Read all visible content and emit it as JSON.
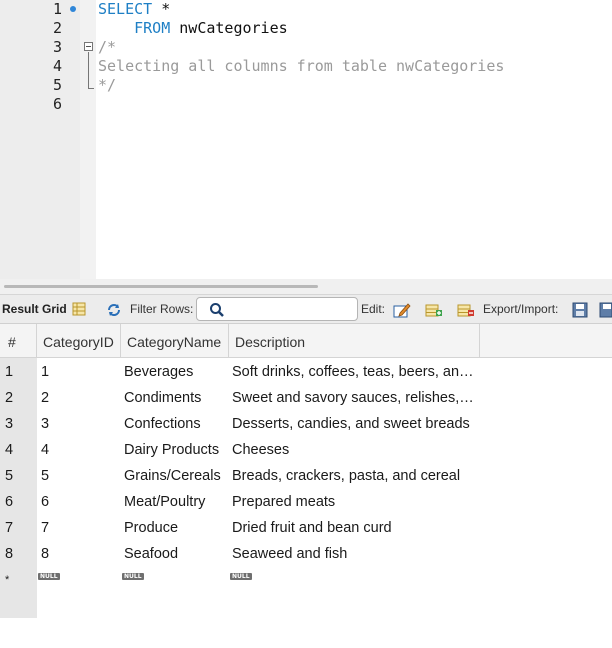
{
  "editor": {
    "lines": [
      {
        "num": "1",
        "keyword": "SELECT",
        "text": " *"
      },
      {
        "num": "2",
        "indent": "    ",
        "keyword": "FROM",
        "text": " nwCategories"
      },
      {
        "num": "3",
        "comment": "/*"
      },
      {
        "num": "4",
        "comment": "Selecting all columns from table nwCategories"
      },
      {
        "num": "5",
        "comment": "*/"
      },
      {
        "num": "6"
      }
    ]
  },
  "toolbar": {
    "result_grid_label": "Result Grid",
    "filter_rows_label": "Filter Rows:",
    "search_value": "",
    "edit_label": "Edit:",
    "export_label": "Export/Import:"
  },
  "grid": {
    "columns": [
      "#",
      "CategoryID",
      "CategoryName",
      "Description"
    ],
    "rows": [
      {
        "n": "1",
        "id": "1",
        "name": "Beverages",
        "desc": "Soft drinks, coffees, teas, beers, an…"
      },
      {
        "n": "2",
        "id": "2",
        "name": "Condiments",
        "desc": "Sweet and savory sauces, relishes, …"
      },
      {
        "n": "3",
        "id": "3",
        "name": "Confections",
        "desc": "Desserts, candies, and sweet breads"
      },
      {
        "n": "4",
        "id": "4",
        "name": "Dairy Products",
        "desc": "Cheeses"
      },
      {
        "n": "5",
        "id": "5",
        "name": "Grains/Cereals",
        "desc": "Breads, crackers, pasta, and cereal"
      },
      {
        "n": "6",
        "id": "6",
        "name": "Meat/Poultry",
        "desc": "Prepared meats"
      },
      {
        "n": "7",
        "id": "7",
        "name": "Produce",
        "desc": "Dried fruit and bean curd"
      },
      {
        "n": "8",
        "id": "8",
        "name": "Seafood",
        "desc": "Seaweed and fish"
      }
    ],
    "new_row": {
      "n": "*",
      "null_label": "NULL"
    }
  },
  "colors": {
    "keyword": "#1e7fc5",
    "comment": "#9a9a9a",
    "breakpoint": "#2f86d8"
  }
}
